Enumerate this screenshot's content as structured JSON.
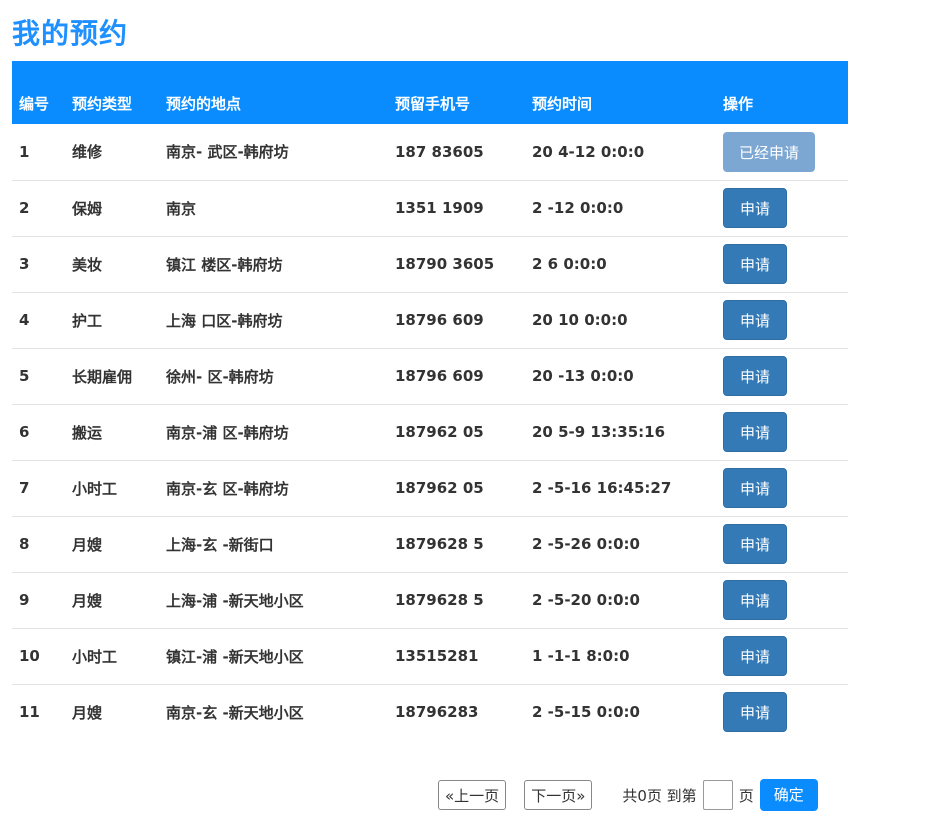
{
  "page_title": "我的预约",
  "table": {
    "headers": [
      "编号",
      "预约类型",
      "预约的地点",
      "预留手机号",
      "预约时间",
      "操作"
    ],
    "rows": [
      {
        "id": "1",
        "type": "维修",
        "location": "南京-  武区-韩府坊",
        "phone": "187    83605",
        "time": "20   4-12 0:0:0",
        "action": "已经申请",
        "applied": true
      },
      {
        "id": "2",
        "type": "保姆",
        "location": "南京",
        "phone": "1351    1909",
        "time": "2      -12 0:0:0",
        "action": "申请",
        "applied": false
      },
      {
        "id": "3",
        "type": "美妆",
        "location": "镇江    楼区-韩府坊",
        "phone": "18790   3605",
        "time": "2      6 0:0:0",
        "action": "申请",
        "applied": false
      },
      {
        "id": "4",
        "type": "护工",
        "location": "上海   口区-韩府坊",
        "phone": "18796    609",
        "time": "20      10 0:0:0",
        "action": "申请",
        "applied": false
      },
      {
        "id": "5",
        "type": "长期雇佣",
        "location": "徐州-    区-韩府坊",
        "phone": "18796    609",
        "time": "20     -13 0:0:0",
        "action": "申请",
        "applied": false
      },
      {
        "id": "6",
        "type": "搬运",
        "location": "南京-浦   区-韩府坊",
        "phone": "187962    05",
        "time": "20   5-9 13:35:16",
        "action": "申请",
        "applied": false
      },
      {
        "id": "7",
        "type": "小时工",
        "location": "南京-玄   区-韩府坊",
        "phone": "187962    05",
        "time": "2    -5-16 16:45:27",
        "action": "申请",
        "applied": false
      },
      {
        "id": "8",
        "type": "月嫂",
        "location": "上海-玄    -新街口",
        "phone": "1879628    5",
        "time": "2    -5-26 0:0:0",
        "action": "申请",
        "applied": false
      },
      {
        "id": "9",
        "type": "月嫂",
        "location": "上海-浦    -新天地小区",
        "phone": "1879628    5",
        "time": "2    -5-20 0:0:0",
        "action": "申请",
        "applied": false
      },
      {
        "id": "10",
        "type": "小时工",
        "location": "镇江-浦    -新天地小区",
        "phone": "13515281    ",
        "time": "1    -1-1 8:0:0",
        "action": "申请",
        "applied": false
      },
      {
        "id": "11",
        "type": "月嫂",
        "location": "南京-玄    -新天地小区",
        "phone": "18796283    ",
        "time": "2    -5-15 0:0:0",
        "action": "申请",
        "applied": false
      }
    ]
  },
  "pager": {
    "prev_label": "«上一页",
    "next_label": "下一页»",
    "total_text": "共0页 到第",
    "page_input_value": "",
    "page_unit": "页",
    "confirm_label": "确定"
  },
  "colors": {
    "title": "#1e90ff",
    "header_bg": "#0a8cff",
    "apply_button": "#337ab7",
    "applied_button": "#7ca7d3",
    "confirm_button": "#0a8cff"
  }
}
